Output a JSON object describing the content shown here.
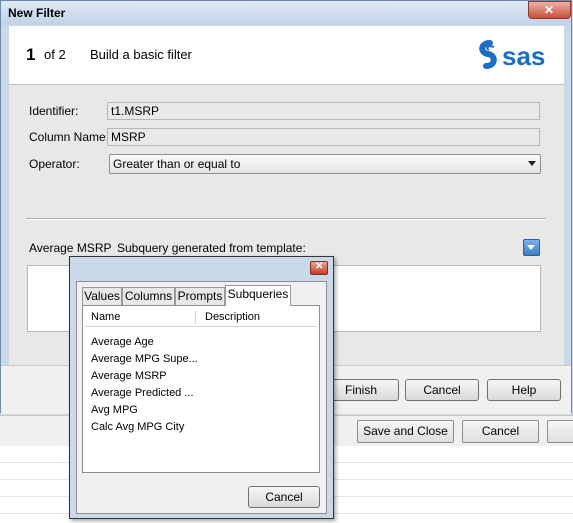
{
  "dialog": {
    "title": "New Filter",
    "close_glyph": "✕",
    "step_number": "1",
    "step_of": "of 2",
    "step_title": "Build a basic filter",
    "logo_text": "sas",
    "identifier_label": "Identifier:",
    "identifier_value": "t1.MSRP",
    "column_name_label": "Column Name:",
    "column_name_value": "MSRP",
    "operator_label": "Operator:",
    "operator_value": "Greater than or equal to",
    "value_label": "Average MSRP",
    "subquery_label": "Subquery generated from template:",
    "buttons": {
      "finish": "Finish",
      "cancel": "Cancel",
      "help": "Help"
    }
  },
  "subquery_popup": {
    "close_glyph": "✕",
    "tabs": [
      "Values",
      "Columns",
      "Prompts",
      "Subqueries"
    ],
    "active_tab": "Subqueries",
    "columns": [
      "Name",
      "Description"
    ],
    "items": [
      "Average Age",
      "Average MPG Supe...",
      "Average MSRP",
      "Average Predicted ...",
      "Avg MPG",
      "Calc Avg MPG City"
    ],
    "cancel_label": "Cancel"
  },
  "background_window": {
    "buttons": {
      "save_and_close": "Save and Close",
      "cancel": "Cancel"
    }
  },
  "colors": {
    "sas_logo_blue": "#1a6fc4",
    "dialog_chrome": "#cbd8e6"
  },
  "icons": [
    "close-icon",
    "dropdown-arrow-icon",
    "sas-logo"
  ]
}
